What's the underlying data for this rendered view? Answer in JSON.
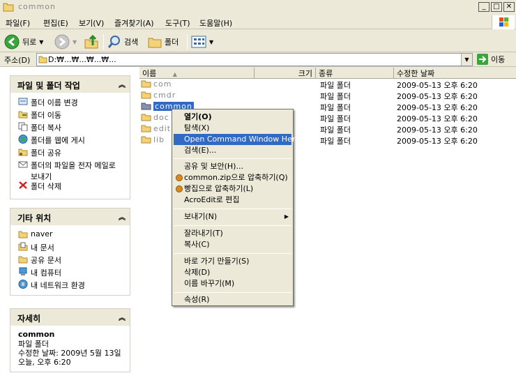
{
  "window": {
    "title": "common",
    "buttons": {
      "minimize": "_",
      "maximize": "□",
      "close": "✕"
    }
  },
  "menubar": {
    "items": [
      "파일(F)",
      "편집(E)",
      "보기(V)",
      "즐겨찾기(A)",
      "도구(T)",
      "도움말(H)"
    ]
  },
  "toolbar": {
    "back_label": "뒤로",
    "search_label": "검색",
    "folders_label": "폴더"
  },
  "address": {
    "label": "주소(D)",
    "value": "D:₩...₩...₩...₩...",
    "go_label": "이동"
  },
  "taskpane": {
    "file_tasks": {
      "title": "파일 및 폴더 작업",
      "items": [
        "폴더 이름 변경",
        "폴더 이동",
        "폴더 복사",
        "폴더를 웹에 게시",
        "폴더 공유",
        "폴더의 파일을 전자 메일로 보내기",
        "폴더 삭제"
      ]
    },
    "other_places": {
      "title": "기타 위치",
      "items": [
        "naver",
        "내 문서",
        "공유 문서",
        "내 컴퓨터",
        "내 네트워크 환경"
      ]
    },
    "details": {
      "title": "자세히",
      "name": "common",
      "type": "파일 폴더",
      "modified": "수정한 날짜: 2009년 5월 13일 오늘, 오후 6:20"
    }
  },
  "filelist": {
    "columns": {
      "name": "이름",
      "size": "크기",
      "type": "종류",
      "modified": "수정한 날짜"
    },
    "rows": [
      {
        "name": "com",
        "type": "파일 폴더",
        "modified": "2009-05-13 오후 6:20"
      },
      {
        "name": "cmdr",
        "type": "파일 폴더",
        "modified": "2009-05-13 오후 6:20"
      },
      {
        "name": "common",
        "type": "파일 폴더",
        "modified": "2009-05-13 오후 6:20"
      },
      {
        "name": "doc",
        "type": "파일 폴더",
        "modified": "2009-05-13 오후 6:20"
      },
      {
        "name": "edit",
        "type": "파일 폴더",
        "modified": "2009-05-13 오후 6:20"
      },
      {
        "name": "lib",
        "type": "파일 폴더",
        "modified": "2009-05-13 오후 6:20"
      }
    ]
  },
  "context_menu": {
    "items": [
      "열기(O)",
      "탐색(X)",
      "Open Command Window Here",
      "검색(E)...",
      "공유 및 보안(H)...",
      "common.zip으로 압축하기(Q)",
      "빵집으로 압축하기(L)",
      "AcroEdit로 편집",
      "보내기(N)",
      "잘라내기(T)",
      "복사(C)",
      "바로 가기 만들기(S)",
      "삭제(D)",
      "이름 바꾸기(M)",
      "속성(R)"
    ],
    "submenu_arrow": "▶"
  },
  "colors": {
    "selection": "#316ac5",
    "window_bg": "#ece9d8",
    "folder": "#f3d27a"
  }
}
